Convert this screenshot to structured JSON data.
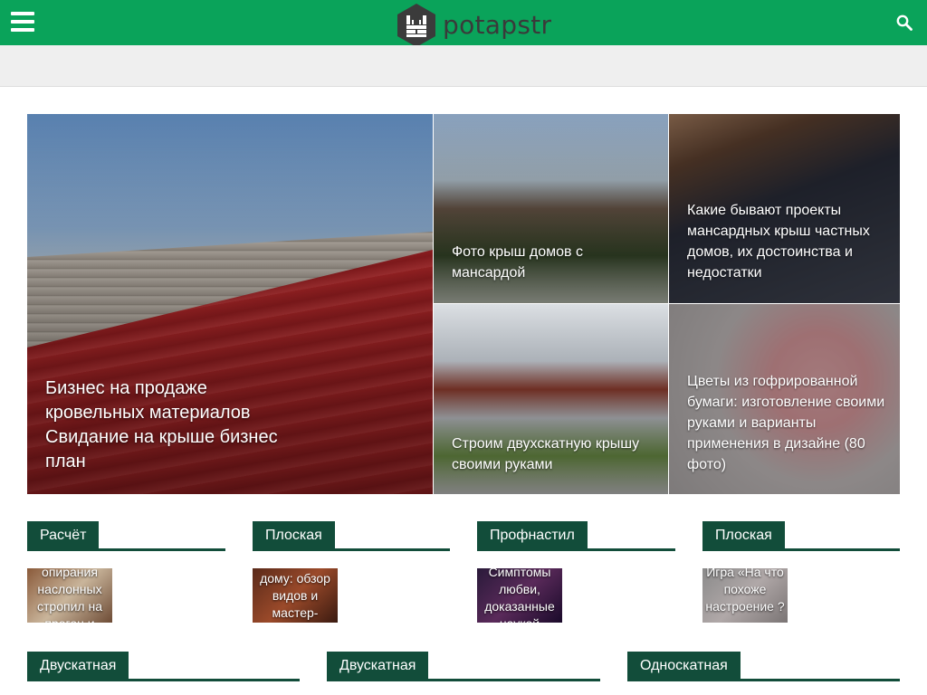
{
  "header": {
    "menu_icon": "hamburger-menu-icon",
    "logo_text": "potapstr",
    "logo_icon": "brick-wall-hexagon-icon",
    "search_icon": "search-icon",
    "brand_color": "#0aa35a"
  },
  "featured": [
    {
      "title": "Бизнес на продаже кровельных материалов Свидание на крыше бизнес план"
    },
    {
      "title": "Фото крыш домов с мансардой"
    },
    {
      "title": "Какие бывают проекты мансардных крыш частных домов, их достоинства и недостатки"
    },
    {
      "title": "Строим двухскатную крышу своими руками"
    },
    {
      "title": "Цветы из гофрированной бумаги: изготовление своими руками и варианты применения в дизайне (80 фото)"
    }
  ],
  "categories_row1": [
    {
      "label": "Расчёт",
      "thumb_text": "Узлы опирания наслонных стропил на прогон и"
    },
    {
      "label": "Плоская",
      "thumb_text": "дому: обзор видов и мастер-"
    },
    {
      "label": "Профнастил",
      "thumb_text": "Симптомы любви, доказанные наукой"
    },
    {
      "label": "Плоская",
      "thumb_text": "Игра «На что похоже настроение ?"
    }
  ],
  "categories_row2": [
    {
      "label": "Двускатная"
    },
    {
      "label": "Двускатная"
    },
    {
      "label": "Односкатная"
    }
  ],
  "colors": {
    "accent_dark": "#124d3a",
    "subheader_bg": "#efefef"
  }
}
